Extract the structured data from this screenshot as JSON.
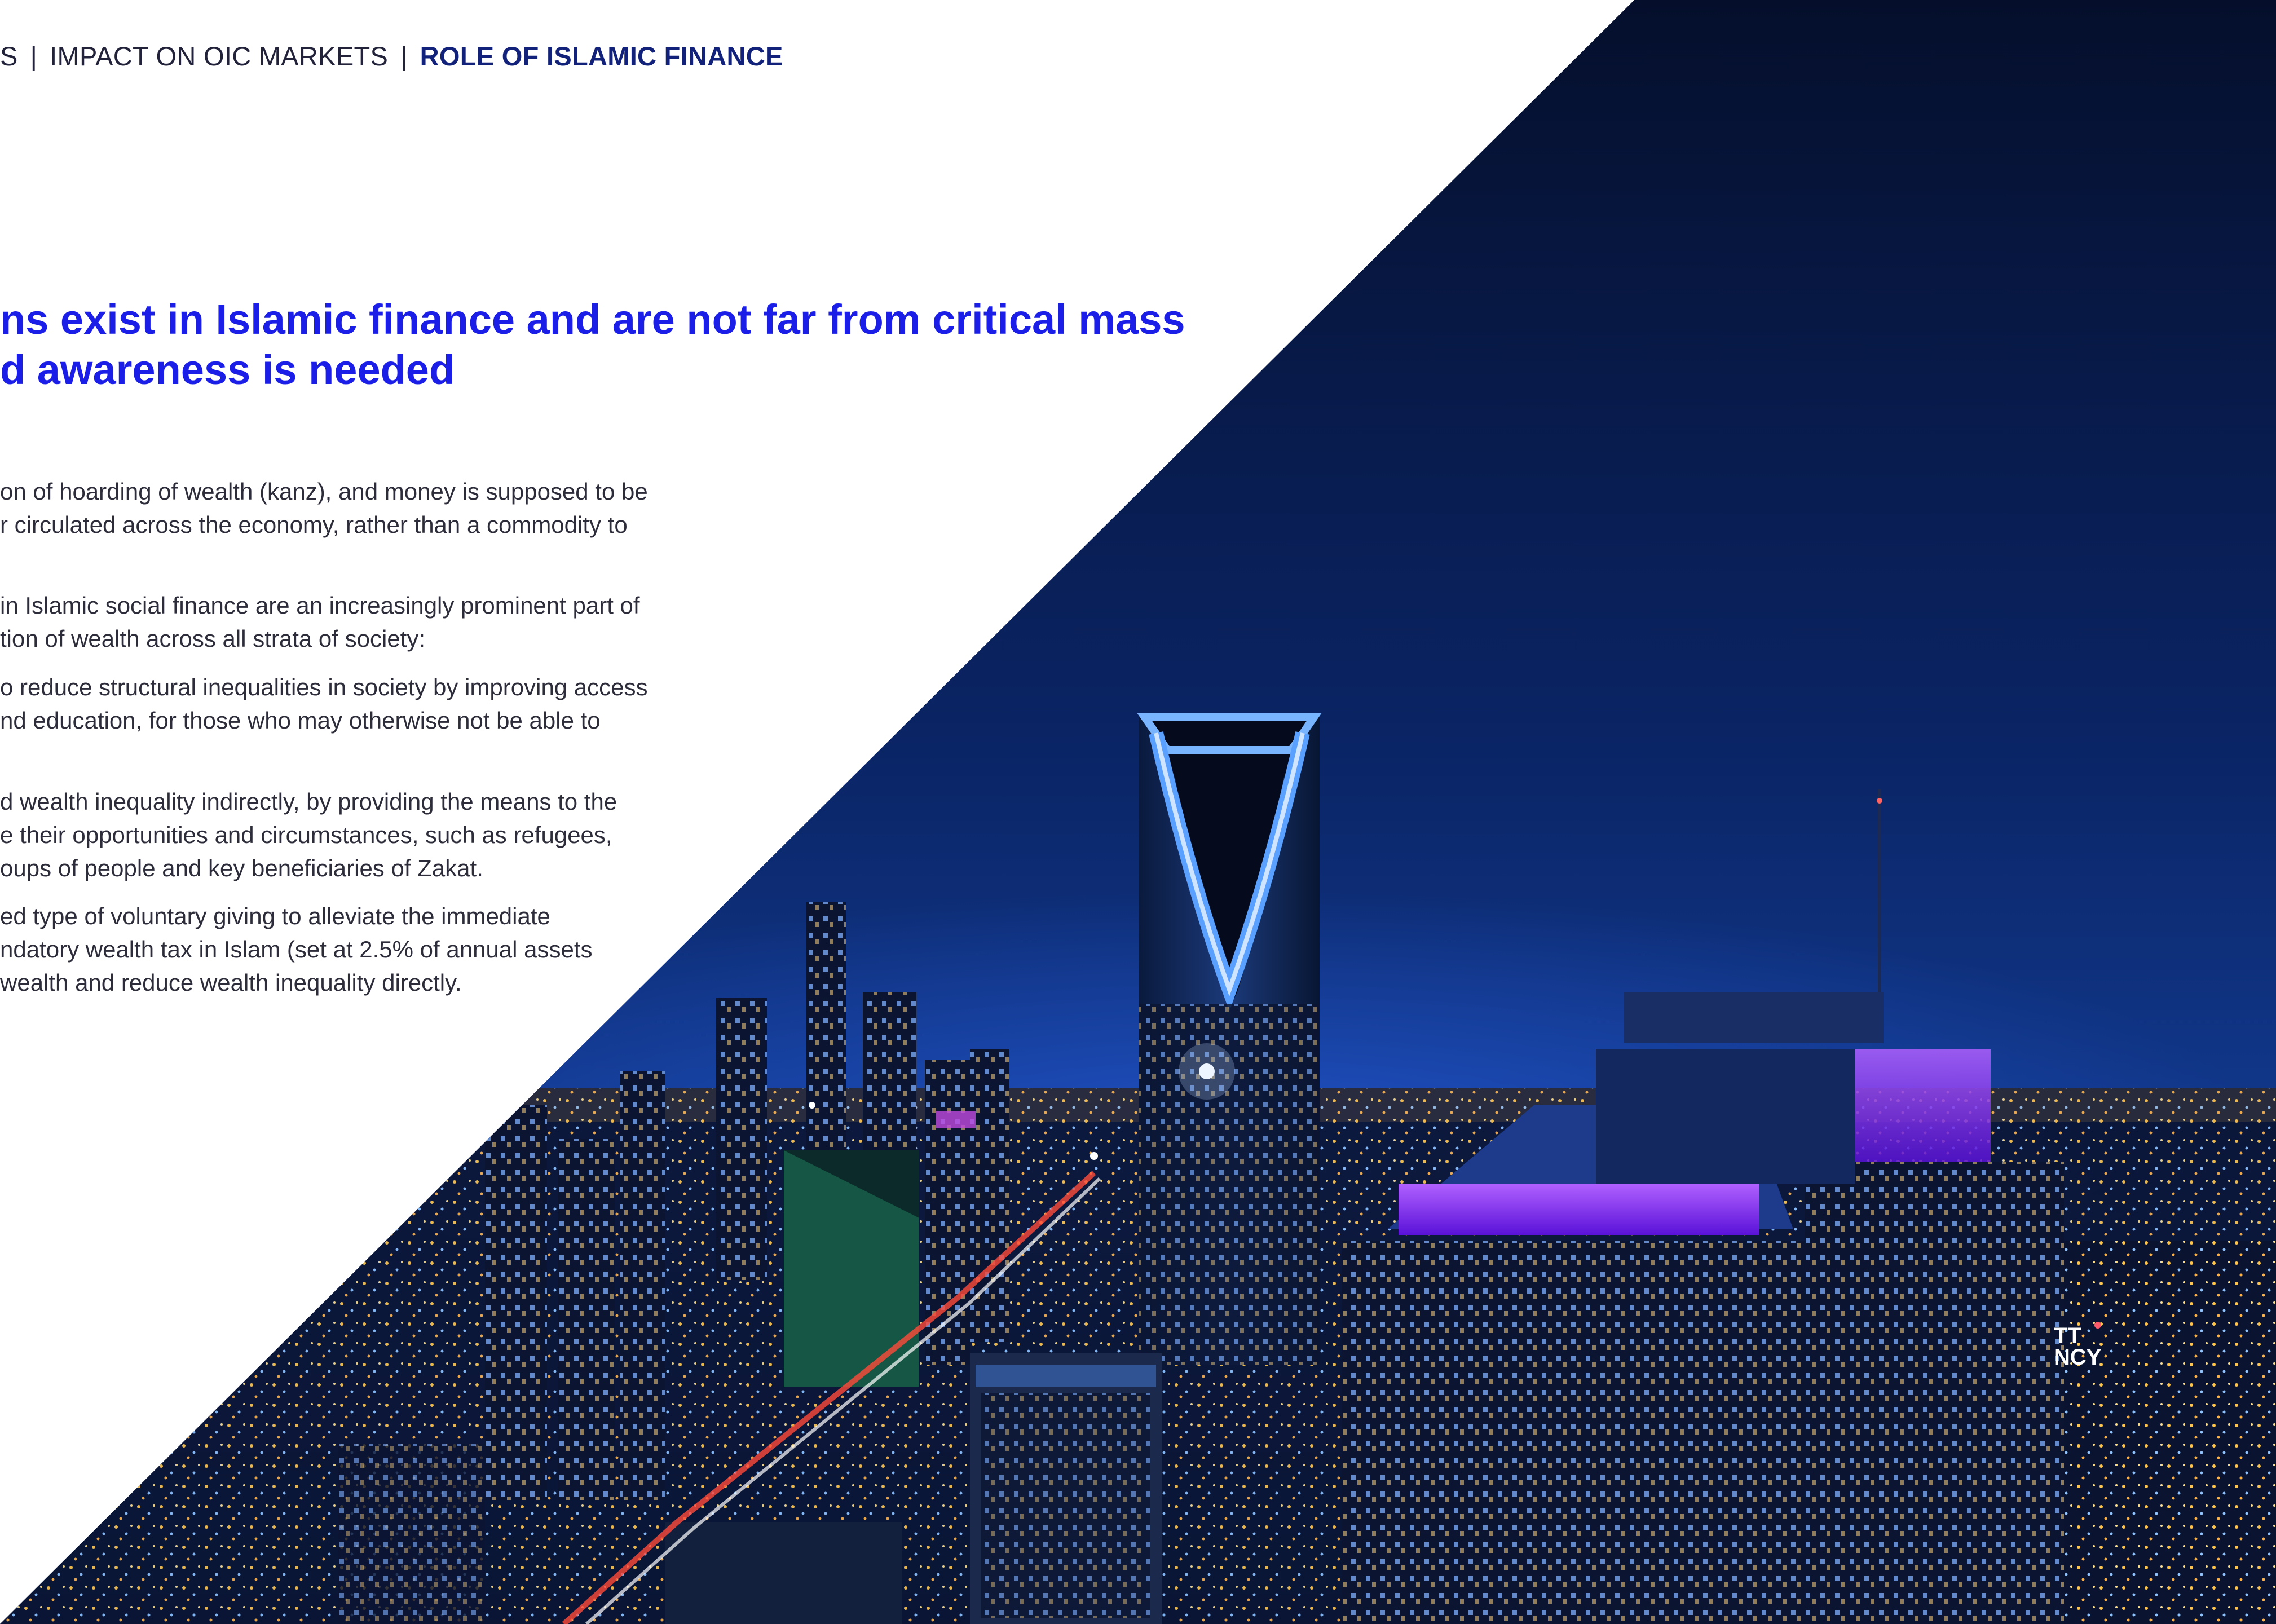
{
  "breadcrumb": {
    "items": [
      "S",
      "IMPACT ON OIC MARKETS",
      "ROLE OF ISLAMIC FINANCE"
    ],
    "separator": "|"
  },
  "headline": {
    "lines": [
      "ns exist in Islamic finance and are not far from critical mass",
      "d awareness is needed"
    ]
  },
  "paragraphs": [
    [
      "on of hoarding of wealth (kanz), and money is supposed to be",
      "r circulated across the economy, rather than a commodity to"
    ],
    [
      "in Islamic social finance are an increasingly prominent part of",
      "tion of wealth across all strata of society:"
    ],
    [
      "o reduce structural inequalities in society by improving access",
      "nd education, for those who may otherwise not be able to"
    ],
    [
      "d wealth inequality indirectly, by providing the means to the",
      "e their opportunities and circumstances, such as refugees,",
      "oups of people and key beneficiaries of Zakat."
    ],
    [
      "ed type of voluntary giving to alleviate the immediate",
      "ndatory wealth tax in Islam (set at 2.5% of annual assets",
      "wealth and reduce wealth inequality directly."
    ]
  ],
  "photo": {
    "subject": "night-city-skyline-with-tower",
    "sign_text": [
      "TT",
      "NCY"
    ],
    "colors": {
      "sky_top": "#061233",
      "sky_bottom": "#0f3a8c",
      "tower_glow": "#4a8cff",
      "purple": "#8a2cff",
      "lights": "#ffc54a"
    }
  },
  "colors": {
    "headline": "#1a1ee6",
    "breadcrumb_active": "#12217a",
    "text": "#2c2c3a"
  }
}
